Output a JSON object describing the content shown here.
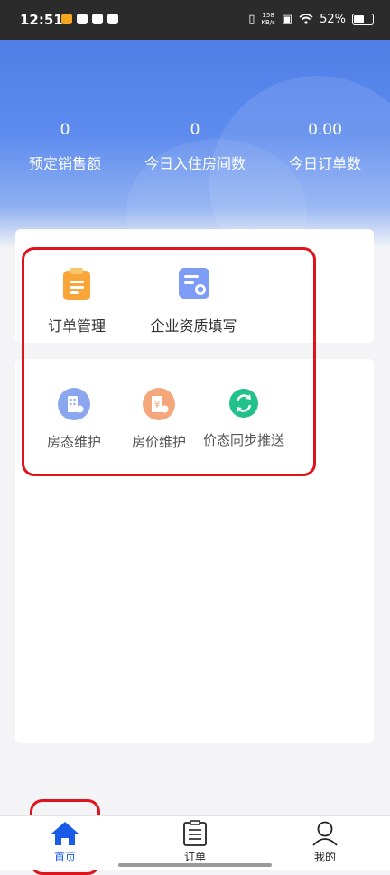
{
  "statusbar": {
    "time": "12:51",
    "speed_top": "158",
    "speed_bottom": "KB/s",
    "battery": "52%"
  },
  "stats": [
    {
      "value": "0",
      "label": "预定销售额"
    },
    {
      "value": "0",
      "label": "今日入住房间数"
    },
    {
      "value": "0.00",
      "label": "今日订单数"
    }
  ],
  "management": {
    "items": [
      {
        "label": "订单管理",
        "icon": "clipboard-icon"
      },
      {
        "label": "企业资质填写",
        "icon": "certificate-icon"
      }
    ]
  },
  "maintenance": {
    "items": [
      {
        "label": "房态维护",
        "icon": "building-icon"
      },
      {
        "label": "房价维护",
        "icon": "price-icon"
      },
      {
        "label": "价态同步推送",
        "icon": "sync-icon"
      }
    ]
  },
  "tabbar": {
    "items": [
      {
        "label": "首页",
        "icon": "home-icon"
      },
      {
        "label": "订单",
        "icon": "order-list-icon"
      },
      {
        "label": "我的",
        "icon": "user-icon"
      }
    ],
    "active_color": "#1a5be8"
  },
  "colors": {
    "hero_blue": "#4f7fe6",
    "highlight_red": "#e0131d",
    "clipboard_orange": "#f9a53a",
    "certificate_blue": "#7d9cf5",
    "sync_green": "#22c08a"
  }
}
